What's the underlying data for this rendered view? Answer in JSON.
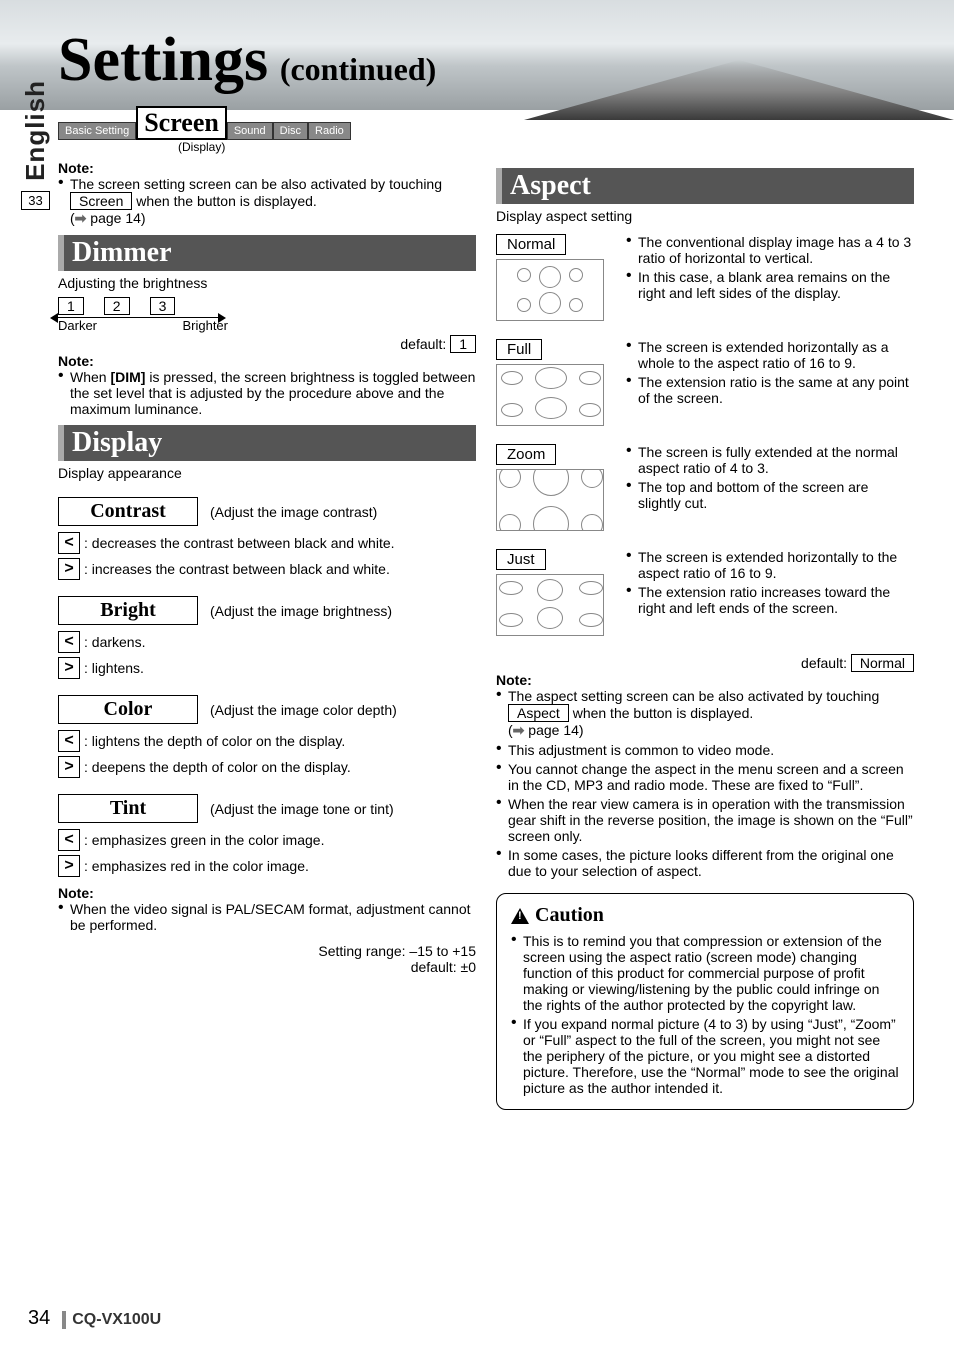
{
  "page": {
    "language_tab": "English",
    "language_page_ref": "33",
    "number": "34",
    "model": "CQ-VX100U"
  },
  "title": {
    "main": "Settings",
    "suffix": "(continued)"
  },
  "tabs": {
    "basic": "Basic Setting",
    "screen": "Screen",
    "screen_sub": "(Display)",
    "sound": "Sound",
    "disc": "Disc",
    "radio": "Radio"
  },
  "screen_note": {
    "label": "Note:",
    "text_1": "The screen setting screen can be also activated by touching ",
    "button": "Screen",
    "text_2": " when the button is displayed.",
    "page_ref": "page 14)"
  },
  "dimmer": {
    "title": "Dimmer",
    "subtitle": "Adjusting the brightness",
    "levels": [
      "1",
      "2",
      "3"
    ],
    "darker": "Darker",
    "brighter": "Brighter",
    "default_label": "default:",
    "default_value": "1",
    "note_label": "Note:",
    "note_text": "When [DIM] is pressed, the screen brightness is toggled between the set level that is adjusted by the procedure above and the maximum luminance."
  },
  "display": {
    "title": "Display",
    "subtitle": "Display appearance",
    "contrast": {
      "name": "Contrast",
      "desc": "(Adjust the image contrast)",
      "dec": ": decreases the contrast between black and white.",
      "inc": ": increases the contrast between black and white."
    },
    "bright": {
      "name": "Bright",
      "desc": "(Adjust the image brightness)",
      "dec": ": darkens.",
      "inc": ": lightens."
    },
    "color": {
      "name": "Color",
      "desc": "(Adjust the image color depth)",
      "dec": ": lightens the depth of color on the display.",
      "inc": ": deepens the depth of color on the display."
    },
    "tint": {
      "name": "Tint",
      "desc": "(Adjust the image tone or tint)",
      "dec": ": emphasizes green in the color image.",
      "inc": ": emphasizes red in the color image."
    },
    "note_label": "Note:",
    "note_text": "When the video signal is PAL/SECAM format, adjustment cannot be performed.",
    "range": "Setting range: –15 to +15",
    "default": "default: ±0"
  },
  "aspect": {
    "title": "Aspect",
    "subtitle": "Display aspect setting",
    "normal": {
      "label": "Normal",
      "b1": "The conventional display image has a 4 to 3 ratio of horizontal to vertical.",
      "b2": "In this case, a blank area remains on the right and left sides of the display."
    },
    "full": {
      "label": "Full",
      "b1": "The screen is extended horizontally as a whole to the aspect ratio of 16 to 9.",
      "b2": "The extension ratio is the same at any point of the screen."
    },
    "zoom": {
      "label": "Zoom",
      "b1": "The screen is fully extended at the normal aspect ratio of 4 to 3.",
      "b2": "The top and bottom of the screen are slightly cut."
    },
    "just": {
      "label": "Just",
      "b1": "The screen is extended horizontally to the aspect ratio of 16 to 9.",
      "b2": "The extension ratio increases toward the right and left ends of the screen."
    },
    "default_label": "default:",
    "default_value": "Normal",
    "note_label": "Note:",
    "n1a": "The aspect setting screen can be also activated by touching ",
    "n1_button": "Aspect",
    "n1b": " when the button is displayed.",
    "n1_page": "page 14)",
    "n2": "This adjustment is common to video mode.",
    "n3": "You cannot change the aspect in the menu screen and a screen in the CD, MP3 and radio mode. These are fixed to “Full”.",
    "n4": "When the rear view camera is in operation with the transmission gear shift in the reverse position, the image is shown on the “Full” screen only.",
    "n5": "In some cases, the picture looks different from the original one due to your selection of aspect."
  },
  "caution": {
    "title": "Caution",
    "b1": "This is to remind you that compression or extension of the screen using the aspect ratio (screen mode) changing function of this product for commercial purpose of profit making or viewing/listening by the public could infringe on the rights of the author protected by the copyright law.",
    "b2": "If you expand normal picture (4 to 3) by using “Just”, “Zoom” or “Full” aspect to the full of the screen, you might not see the periphery of the picture, or you might see a distorted picture. Therefore, use the “Normal” mode to see the original picture as the author intended it."
  }
}
